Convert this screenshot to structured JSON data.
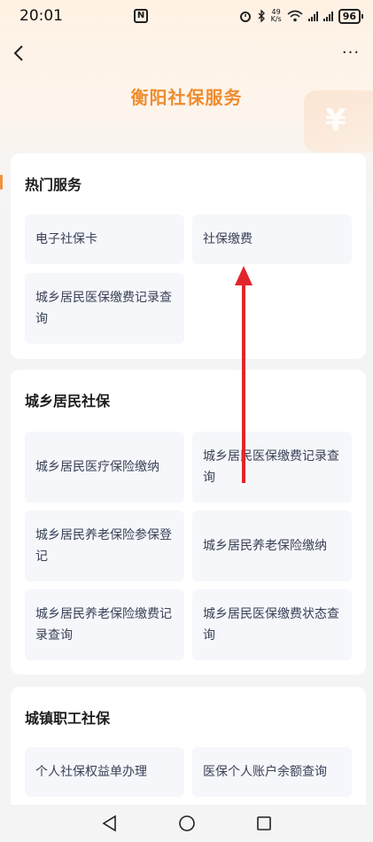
{
  "status_bar": {
    "time": "20:01",
    "nfc_label": "N",
    "net_speed_value": "49",
    "net_speed_unit": "K/s",
    "battery": "96"
  },
  "header": {
    "title": "衡阳社保服务",
    "back_icon": "chevron-left-icon",
    "more_label": "···",
    "deco_symbol": "¥"
  },
  "sections": {
    "hot": {
      "title": "热门服务",
      "items": [
        "电子社保卡",
        "社保缴费",
        "城乡居民医保缴费记录查询"
      ]
    },
    "urban_rural": {
      "title": "城乡居民社保",
      "items": [
        "城乡居民医疗保险缴纳",
        "城乡居民医保缴费记录查询",
        "城乡居民养老保险参保登记",
        "城乡居民养老保险缴纳",
        "城乡居民养老保险缴费记录查询",
        "城乡居民医保缴费状态查询"
      ]
    },
    "employee": {
      "title": "城镇职工社保",
      "items": [
        "个人社保权益单办理",
        "医保个人账户余额查询"
      ]
    }
  },
  "colors": {
    "accent": "#ef8c2e",
    "arrow": "#e0262b",
    "tile_bg": "#f6f7fb"
  }
}
